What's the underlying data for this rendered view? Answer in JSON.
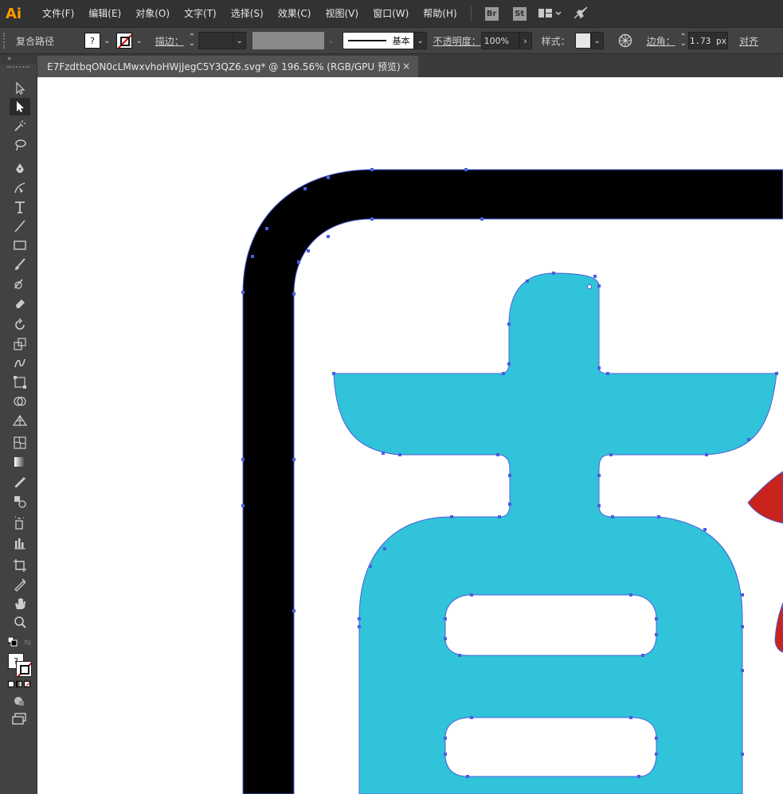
{
  "app": {
    "logo": "Ai"
  },
  "menu": {
    "items": [
      "文件(F)",
      "编辑(E)",
      "对象(O)",
      "文字(T)",
      "选择(S)",
      "效果(C)",
      "视图(V)",
      "窗口(W)",
      "帮助(H)"
    ],
    "bridge": "Br",
    "stock": "St"
  },
  "control": {
    "selection_label": "复合路径",
    "fill_value": "?",
    "stroke_label": "描边：",
    "stroke_profile": "基本",
    "opacity_label": "不透明度：",
    "opacity_value": "100%",
    "style_label": "样式：",
    "corner_label": "边角：",
    "corner_value": "1.73 px",
    "align_label": "对齐"
  },
  "document": {
    "tab_title": "E7FzdtbqON0cLMwxvhoHWjJegC5Y3QZ6.svg* @ 196.56% (RGB/GPU 预览)",
    "close": "×"
  },
  "tools_panel": {
    "collapse": "»",
    "fill_unknown": "?",
    "icons": [
      "selection-tool-icon",
      "direct-selection-tool-icon",
      "magic-wand-icon",
      "lasso-icon",
      "pen-tool-icon",
      "curvature-tool-icon",
      "type-tool-icon",
      "line-tool-icon",
      "rectangle-tool-icon",
      "paintbrush-icon",
      "shaper-tool-icon",
      "eraser-icon",
      "rotate-tool-icon",
      "scale-tool-icon",
      "warp-tool-icon",
      "free-transform-icon",
      "shape-builder-icon",
      "perspective-grid-icon",
      "mesh-tool-icon",
      "gradient-tool-icon",
      "eyedropper-icon",
      "blend-tool-icon",
      "symbol-sprayer-icon",
      "column-graph-icon",
      "artboard-tool-icon",
      "slice-tool-icon",
      "hand-tool-icon",
      "zoom-tool-icon"
    ]
  },
  "colors": {
    "accent_logo": "#ff9a00",
    "artwork_cyan": "#31c3d9",
    "artwork_black": "#000000",
    "artwork_red": "#c8231c",
    "path_highlight": "#4a5fe0",
    "ui_dark": "#323232",
    "ui_panel": "#424242"
  }
}
